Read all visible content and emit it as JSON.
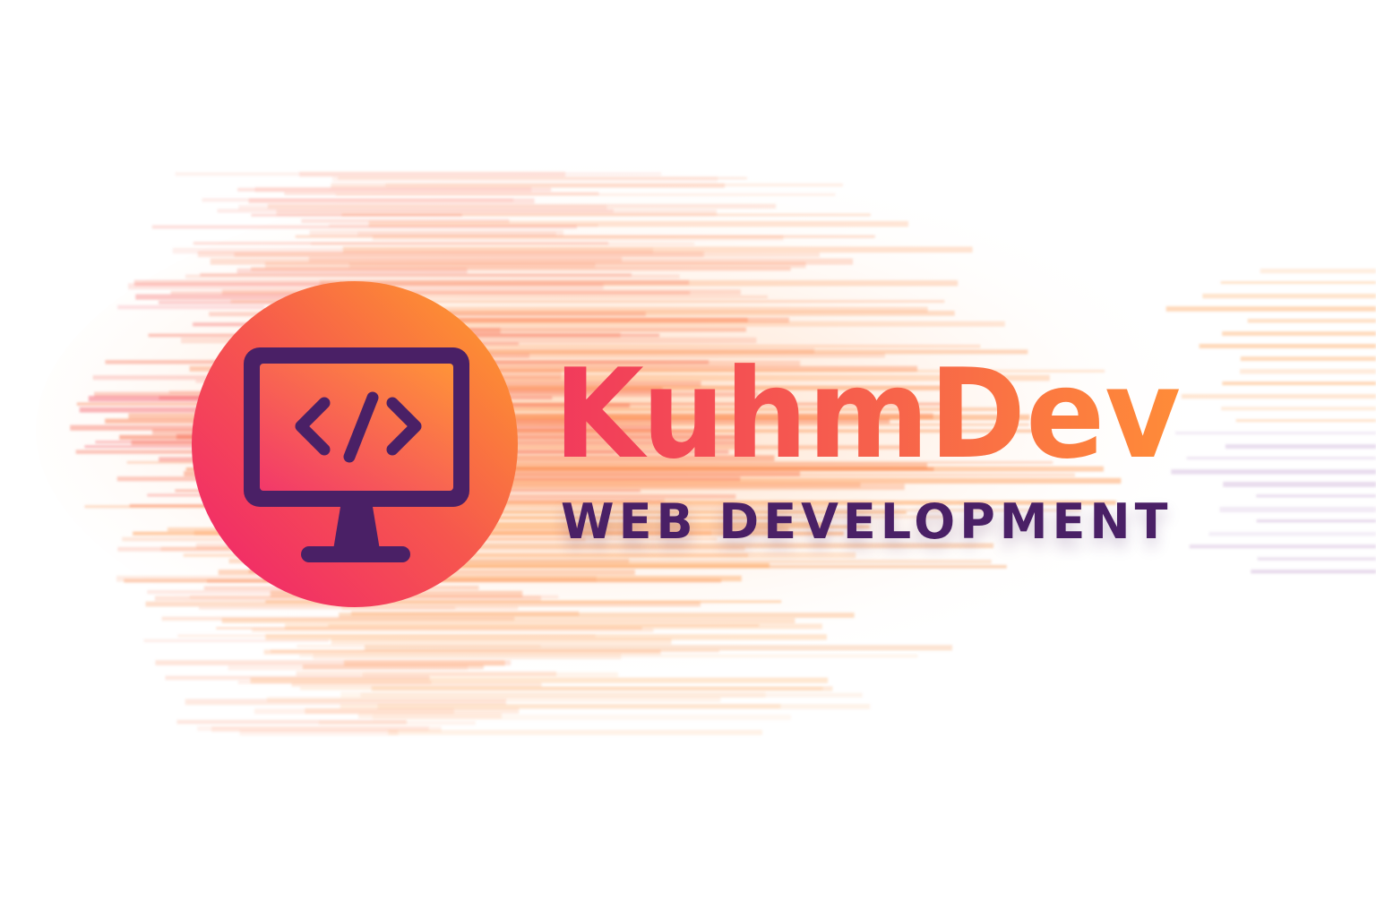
{
  "brand": {
    "name": "KuhmDev",
    "tagline": "WEB DEVELOPMENT"
  },
  "icons": {
    "monitor": "monitor-code-icon",
    "code": "code-brackets-icon"
  },
  "colors": {
    "gradient_start": "#f0266f",
    "gradient_mid": "#f65d4c",
    "gradient_end": "#ff9a2e",
    "ink": "#4a2066",
    "background": "#ffffff"
  }
}
